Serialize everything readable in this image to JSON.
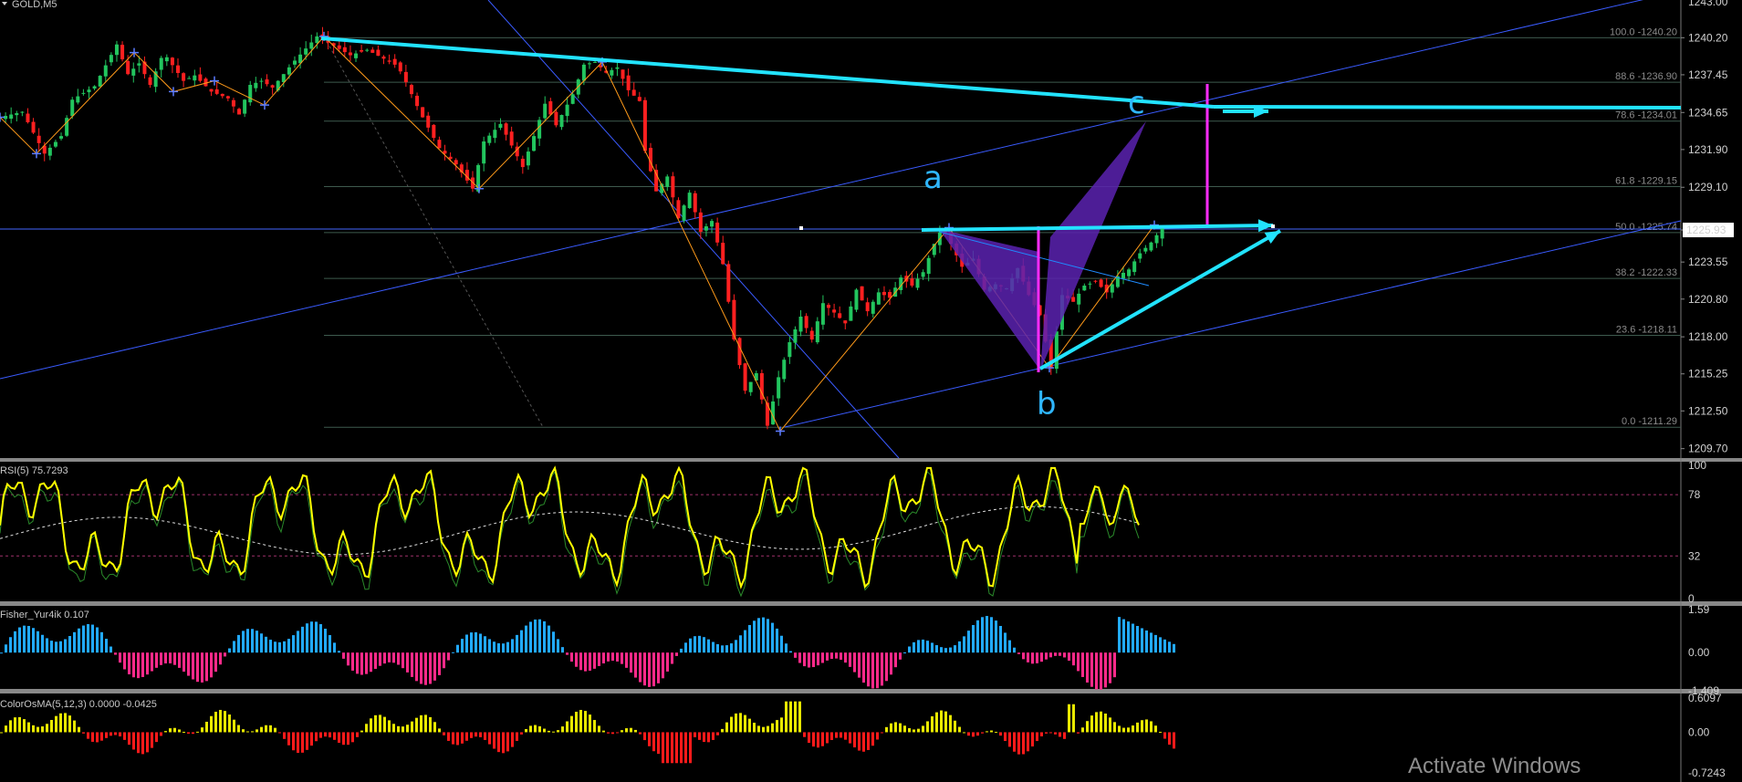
{
  "window": {
    "symbol_label": "GOLD,M5",
    "current_price": "1225.93",
    "top_clipped_price": "1243.00",
    "watermark": "Activate Windows"
  },
  "colors": {
    "background": "#000000",
    "bull": "#22c55e",
    "bear": "#ff2020",
    "trendline": "#22e3ff",
    "channel": "#3a5bff",
    "zigzag": "#ff9a1a",
    "pattern": "#5a22b0",
    "marker": "#ff2cff",
    "rsi": "#ffff00",
    "fisher_pos": "#22aaff",
    "fisher_neg": "#ff2a8a",
    "osma_pos": "#e8e800",
    "osma_neg": "#ff1a1a"
  },
  "chart_data": [
    {
      "type": "line",
      "title": "GOLD,M5",
      "ylim": [
        1209.0,
        1243.0
      ],
      "y_ticks": [
        "1240.20",
        "1237.45",
        "1234.65",
        "1231.90",
        "1229.10",
        "1225.93",
        "1223.55",
        "1220.80",
        "1218.00",
        "1215.25",
        "1212.50",
        "1209.70"
      ],
      "price_path": {
        "x": [
          0,
          20,
          40,
          55,
          65,
          85,
          105,
          115,
          125,
          135,
          147,
          165,
          175,
          190,
          205,
          215,
          225,
          235,
          245,
          265,
          285,
          300,
          315,
          330,
          355,
          360,
          365,
          378,
          395,
          410,
          425,
          435,
          450,
          470,
          480,
          490,
          500,
          515,
          525,
          535,
          545,
          555,
          565,
          575,
          580,
          590,
          600,
          610,
          620,
          630,
          640,
          650,
          660,
          670,
          680,
          690,
          700,
          710,
          720,
          730,
          740,
          750,
          760,
          770,
          780,
          790,
          800,
          810,
          820,
          830,
          840,
          847,
          855,
          865,
          875,
          885,
          895,
          905,
          915,
          925,
          935,
          945,
          955,
          965,
          975,
          985,
          995,
          1005,
          1015,
          1025,
          1035,
          1047
        ],
        "values": [
          1234.3,
          1234.7,
          1231.6,
          1232.9,
          1235.6,
          1236.6,
          1239.7,
          1237.5,
          1238.3,
          1236.7,
          1239.1,
          1237.0,
          1237.4,
          1236.2,
          1235.7,
          1234.5,
          1236.7,
          1237.0,
          1236.5,
          1238.5,
          1240.3,
          1239.6,
          1238.9,
          1239.3,
          1238.2,
          1237.7,
          1236.9,
          1234.6,
          1232.0,
          1230.8,
          1229.0,
          1232.5,
          1233.8,
          1230.6,
          1232.9,
          1235.3,
          1233.7,
          1236.0,
          1238.2,
          1238.4,
          1237.6,
          1238.0,
          1236.3,
          1235.5,
          1231.8,
          1228.8,
          1229.9,
          1226.8,
          1228.7,
          1225.8,
          1226.6,
          1223.4,
          1217.8,
          1214.0,
          1215.3,
          1211.4,
          1215.0,
          1217.6,
          1219.5,
          1217.8,
          1220.5,
          1219.8,
          1219.0,
          1221.5,
          1219.9,
          1221.3,
          1220.9,
          1222.4,
          1221.8,
          1222.8,
          1224.9,
          1226.1,
          1224.9,
          1223.2,
          1223.8,
          1221.5,
          1221.9,
          1221.6,
          1223.1,
          1221.1,
          1219.6,
          1215.7,
          1221.1,
          1220.6,
          1221.8,
          1222.1,
          1221.3,
          1222.5,
          1223.0,
          1224.2,
          1225.0,
          1226.3
        ]
      },
      "fibonacci_levels": [
        {
          "label": "100.0 -1240.20",
          "value": 1240.2
        },
        {
          "label": "88.6 -1236.90",
          "value": 1236.9
        },
        {
          "label": "78.6 -1234.01",
          "value": 1234.01
        },
        {
          "label": "61.8 -1229.15",
          "value": 1229.15
        },
        {
          "label": "50.0 -1225.74",
          "value": 1225.74
        },
        {
          "label": "38.2 -1222.33",
          "value": 1222.33
        },
        {
          "label": "23.6 -1218.11",
          "value": 1218.11
        },
        {
          "label": "0.0 -1211.29",
          "value": 1211.29
        }
      ],
      "wave_labels": [
        "a",
        "b",
        "c"
      ]
    },
    {
      "type": "line",
      "title": "RSI(5) 75.7293",
      "ylim": [
        0,
        100
      ],
      "levels": [
        78,
        32
      ],
      "y_ticks": [
        "100",
        "78",
        "32",
        "0"
      ],
      "current_value": 75.7293
    },
    {
      "type": "bar",
      "title": "Fisher_Yur4ik 0.107",
      "ylim": [
        -1.409,
        1.59
      ],
      "y_ticks": [
        "1.59",
        "0.00",
        "-1.409"
      ],
      "current_value": 0.107
    },
    {
      "type": "bar",
      "title": "ColorOsMA(5,12,3) 0.0000 -0.0425",
      "ylim": [
        -0.7243,
        0.6097
      ],
      "y_ticks": [
        "0.6097",
        "0.00",
        "-0.7243"
      ],
      "current_values": [
        0.0,
        -0.0425
      ]
    }
  ]
}
